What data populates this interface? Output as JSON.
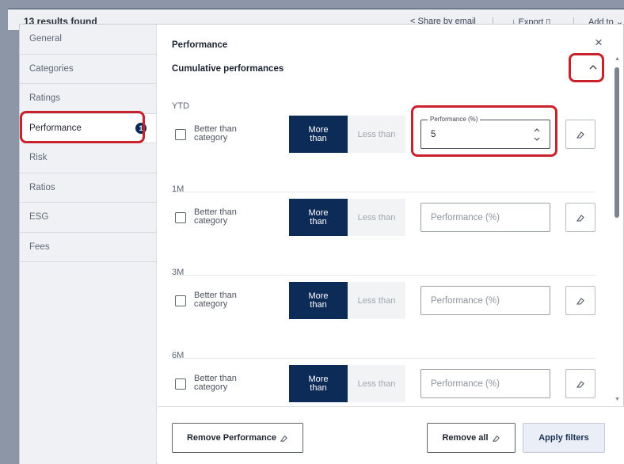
{
  "background": {
    "results_text": "13 results found",
    "share_label": "Share by email",
    "export_label": "Export",
    "addto_label": "Add to"
  },
  "sidebar": {
    "items": [
      {
        "label": "General"
      },
      {
        "label": "Categories"
      },
      {
        "label": "Ratings"
      },
      {
        "label": "Performance",
        "badge": "1"
      },
      {
        "label": "Risk"
      },
      {
        "label": "Ratios"
      },
      {
        "label": "ESG"
      },
      {
        "label": "Fees"
      }
    ]
  },
  "panel": {
    "title": "Performance",
    "section_title": "Cumulative performances",
    "rows": [
      {
        "label": "YTD",
        "checkbox_label": "Better than category",
        "more_label": "More than",
        "less_label": "Less than",
        "input_float_label": "Performance (%)",
        "input_value": "5",
        "input_placeholder": ""
      },
      {
        "label": "1M",
        "checkbox_label": "Better than category",
        "more_label": "More than",
        "less_label": "Less than",
        "input_float_label": "",
        "input_value": "",
        "input_placeholder": "Performance (%)"
      },
      {
        "label": "3M",
        "checkbox_label": "Better than category",
        "more_label": "More than",
        "less_label": "Less than",
        "input_float_label": "",
        "input_value": "",
        "input_placeholder": "Performance (%)"
      },
      {
        "label": "6M",
        "checkbox_label": "Better than category",
        "more_label": "More than",
        "less_label": "Less than",
        "input_float_label": "",
        "input_value": "",
        "input_placeholder": "Performance (%)"
      }
    ]
  },
  "footer": {
    "remove_performance_label": "Remove Performance",
    "remove_all_label": "Remove all",
    "apply_label": "Apply filters"
  },
  "colors": {
    "accent": "#0d2b57",
    "highlight": "#c8232c"
  }
}
